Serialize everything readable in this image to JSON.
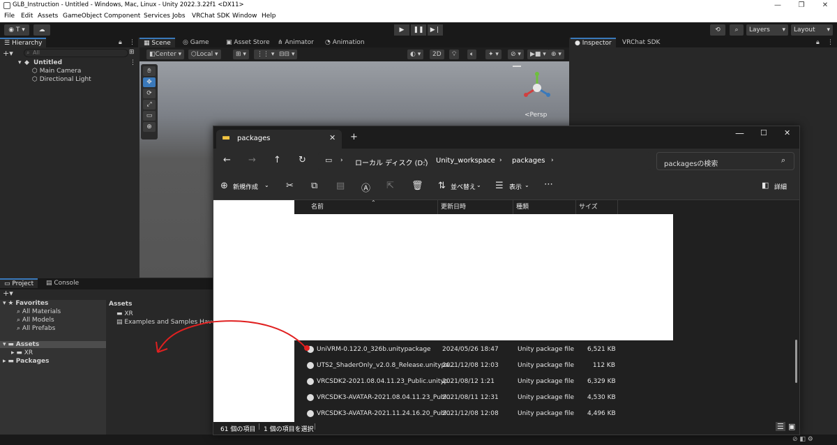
{
  "window": {
    "title": "GLB_Instruction - Untitled - Windows, Mac, Linux - Unity 2022.3.22f1 <DX11>"
  },
  "menu": [
    "File",
    "Edit",
    "Assets",
    "GameObject",
    "Component",
    "Services",
    "Jobs",
    "VRChat SDK",
    "Window",
    "Help"
  ],
  "toolbar": {
    "account_label": "T",
    "layers_label": "Layers",
    "layout_label": "Layout"
  },
  "hierarchy": {
    "tab_label": "Hierarchy",
    "search_placeholder": "All",
    "scene_name": "Untitled",
    "items": [
      "Main Camera",
      "Directional Light"
    ]
  },
  "scene_tabs": [
    "Scene",
    "Game",
    "Asset Store",
    "Animator",
    "Animation"
  ],
  "scene_toolbar": {
    "pivot_label": "Center",
    "space_label": "Local",
    "mode_2d": "2D",
    "persp_label": "<Persp"
  },
  "inspector_tabs": [
    "Inspector",
    "VRChat SDK"
  ],
  "project": {
    "tabs": [
      "Project",
      "Console"
    ],
    "favorites_label": "Favorites",
    "favorites": [
      "All Materials",
      "All Models",
      "All Prefabs"
    ],
    "tree_assets": "Assets",
    "tree_xr": "XR",
    "tree_packages": "Packages",
    "breadcrumb": "Assets",
    "grid_items": [
      "XR",
      "Examples and Samples Have M"
    ]
  },
  "explorer": {
    "tab_title": "packages",
    "breadcrumb": [
      "ローカル ディスク (D:)",
      "Unity_workspace",
      "packages"
    ],
    "search_placeholder": "packagesの検索",
    "cmd": {
      "new": "新規作成",
      "sort": "並べ替え",
      "view": "表示",
      "details": "詳細"
    },
    "columns": [
      "名前",
      "更新日時",
      "種類",
      "サイズ"
    ],
    "files": [
      {
        "name": "UniVRM-0.122.0_326b.unitypackage",
        "date": "2024/05/26 18:47",
        "type": "Unity package file",
        "size": "6,521 KB"
      },
      {
        "name": "UTS2_ShaderOnly_v2.0.8_Release.unitypa...",
        "date": "2021/12/08 12:03",
        "type": "Unity package file",
        "size": "112 KB"
      },
      {
        "name": "VRCSDK2-2021.08.04.11.23_Public.unityp...",
        "date": "2021/08/12 1:21",
        "type": "Unity package file",
        "size": "6,329 KB"
      },
      {
        "name": "VRCSDK3-AVATAR-2021.08.04.11.23_Publ...",
        "date": "2021/08/11 12:31",
        "type": "Unity package file",
        "size": "4,530 KB"
      },
      {
        "name": "VRCSDK3-AVATAR-2021.11.24.16.20_Publ...",
        "date": "2021/12/08 12:08",
        "type": "Unity package file",
        "size": "4,496 KB"
      }
    ],
    "status_count": "61 個の項目",
    "status_selected": "1 個の項目を選択"
  },
  "colors": {
    "accent": "#3a79bb",
    "annotation_arrow": "#e02020"
  }
}
